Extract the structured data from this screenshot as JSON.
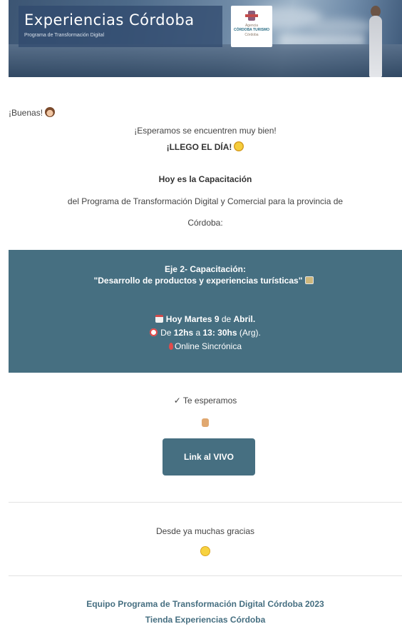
{
  "header": {
    "brand_title": "Experiencias Córdoba",
    "brand_subtitle": "Programa de Transformación Digital",
    "logo_line1": "Agencia",
    "logo_line2": "CÓRDOBA TURISMO",
    "logo_line3": "Córdoba"
  },
  "intro": {
    "greeting": "¡Buenas!",
    "line1": "¡Esperamos se encuentren muy bien!",
    "line2": "¡LLEGO EL DÍA!",
    "line3": "Hoy es la Capacitación",
    "line4": "del Programa de Transformación Digital y Comercial para la provincia de",
    "line5": "Córdoba:"
  },
  "event": {
    "title": "Eje 2- Capacitación:",
    "subtitle": "\"Desarrollo de productos y experiencias turísticas\"",
    "date_prefix": "Hoy Martes 9",
    "date_mid": " de ",
    "date_month": "Abril.",
    "time_prefix": "De ",
    "time_start": "12hs",
    "time_mid": " a ",
    "time_end": "13: 30hs",
    "time_suffix": " (Arg).",
    "location": "Online Sincrónica"
  },
  "invite": {
    "check_text": "✓ Te esperamos",
    "cta_label": "Link al VIVO"
  },
  "thanks": {
    "text": "Desde ya muchas gracias"
  },
  "footer": {
    "line1": "Equipo Programa de Transformación Digital Córdoba 2023",
    "line2": "Tienda Experiencias Córdoba"
  },
  "colors": {
    "accent": "#466f81",
    "footer_text": "#466f81"
  }
}
